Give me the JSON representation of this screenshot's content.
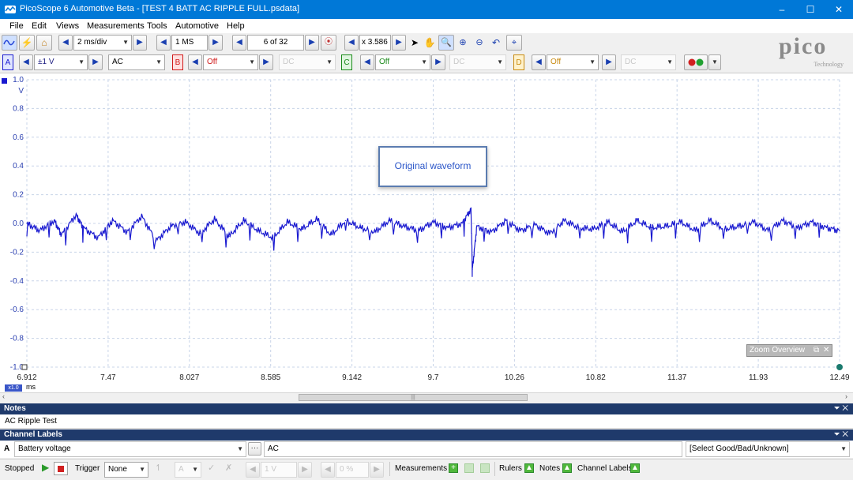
{
  "window": {
    "title": "PicoScope 6 Automotive Beta - [TEST 4 BATT AC RIPPLE FULL.psdata]",
    "minimize": "–",
    "maximize": "☐",
    "close": "✕"
  },
  "menu": [
    "File",
    "Edit",
    "Views",
    "Measurements",
    "Tools",
    "Automotive",
    "Help"
  ],
  "toolbar": {
    "timebase": "2 ms/div",
    "samples": "1 MS",
    "buffer": "6 of 32",
    "zoom": "x 3.586",
    "icons": [
      "scope-icon",
      "probe-wizard-icon",
      "home-icon",
      "pointer-icon",
      "hand-icon",
      "zoom-region-icon",
      "zoom-in-icon",
      "zoom-out-icon",
      "undo-zoom-icon",
      "zoom-fit-icon"
    ]
  },
  "channels": [
    {
      "letter": "A",
      "color": "#1a1ad0",
      "bg": "#e0e6ff",
      "range": "±1 V",
      "coupling": "AC",
      "enabled": true
    },
    {
      "letter": "B",
      "color": "#d01a1a",
      "bg": "#ffe0e0",
      "range": "Off",
      "coupling": "DC",
      "enabled": false
    },
    {
      "letter": "C",
      "color": "#1a8a1a",
      "bg": "#dff5df",
      "range": "Off",
      "coupling": "DC",
      "enabled": false
    },
    {
      "letter": "D",
      "color": "#c88a10",
      "bg": "#fff2cc",
      "range": "Off",
      "coupling": "DC",
      "enabled": false
    }
  ],
  "brand": {
    "name": "pico",
    "sub": "Technology"
  },
  "chart_data": {
    "type": "line",
    "annotation": "Original waveform",
    "yunit": "V",
    "xunit": "ms",
    "xscale_badge": "x1.0",
    "ylim": [
      -1.0,
      1.0
    ],
    "yticks": [
      "1.0",
      "0.8",
      "0.6",
      "0.4",
      "0.2",
      "0.0",
      "-0.2",
      "-0.4",
      "-0.6",
      "-0.8",
      "-1.0"
    ],
    "xlim": [
      6.912,
      12.49
    ],
    "xticks": [
      "6.912",
      "7.47",
      "8.027",
      "8.585",
      "9.142",
      "9.7",
      "10.26",
      "10.82",
      "11.37",
      "11.93",
      "12.49"
    ],
    "grid": true,
    "series": [
      {
        "channel": "A",
        "color": "#1a1ad0",
        "x": [
          6.912,
          7.0,
          7.1,
          7.15,
          7.25,
          7.3,
          7.4,
          7.5,
          7.6,
          7.7,
          7.8,
          7.9,
          8.0,
          8.1,
          8.2,
          8.3,
          8.4,
          8.5,
          8.6,
          8.7,
          8.8,
          8.9,
          9.0,
          9.1,
          9.2,
          9.3,
          9.4,
          9.5,
          9.6,
          9.7,
          9.8,
          9.9,
          9.96,
          9.97,
          10.0,
          10.1,
          10.2,
          10.3,
          10.4,
          10.5,
          10.6,
          10.7,
          10.8,
          10.9,
          11.0,
          11.1,
          11.2,
          11.3,
          11.4,
          11.5,
          11.6,
          11.7,
          11.8,
          11.9,
          12.0,
          12.1,
          12.2,
          12.3,
          12.4,
          12.49
        ],
        "y": [
          0.0,
          -0.05,
          0.02,
          -0.08,
          0.06,
          -0.03,
          -0.1,
          0.02,
          -0.06,
          0.05,
          -0.12,
          -0.02,
          0.01,
          -0.07,
          0.03,
          -0.09,
          0.02,
          -0.05,
          -0.1,
          0.01,
          -0.04,
          0.03,
          -0.08,
          0.02,
          -0.03,
          -0.06,
          0.02,
          -0.02,
          -0.05,
          0.01,
          -0.03,
          0.0,
          0.1,
          -0.32,
          -0.02,
          -0.06,
          0.02,
          -0.05,
          -0.01,
          -0.07,
          0.02,
          -0.03,
          -0.04,
          0.01,
          -0.06,
          0.02,
          -0.03,
          -0.02,
          0.01,
          -0.05,
          0.02,
          -0.04,
          -0.02,
          0.01,
          -0.05,
          0.02,
          -0.03,
          0.01,
          -0.03,
          -0.05
        ]
      }
    ]
  },
  "zoom_overview": {
    "label": "Zoom Overview"
  },
  "notes": {
    "header": "Notes",
    "text": "AC Ripple Test"
  },
  "channel_labels": {
    "header": "Channel Labels",
    "channel": "A",
    "label": "Battery voltage",
    "coupling": "AC",
    "verdict": "[Select Good/Bad/Unknown]"
  },
  "status": {
    "state": "Stopped",
    "trigger_label": "Trigger",
    "trigger_mode": "None",
    "trigger_channel": "A",
    "trigger_level": "1 V",
    "trigger_pct": "0 %",
    "measurements": "Measurements",
    "rulers": "Rulers",
    "notes": "Notes",
    "channel_labels": "Channel Labels"
  }
}
